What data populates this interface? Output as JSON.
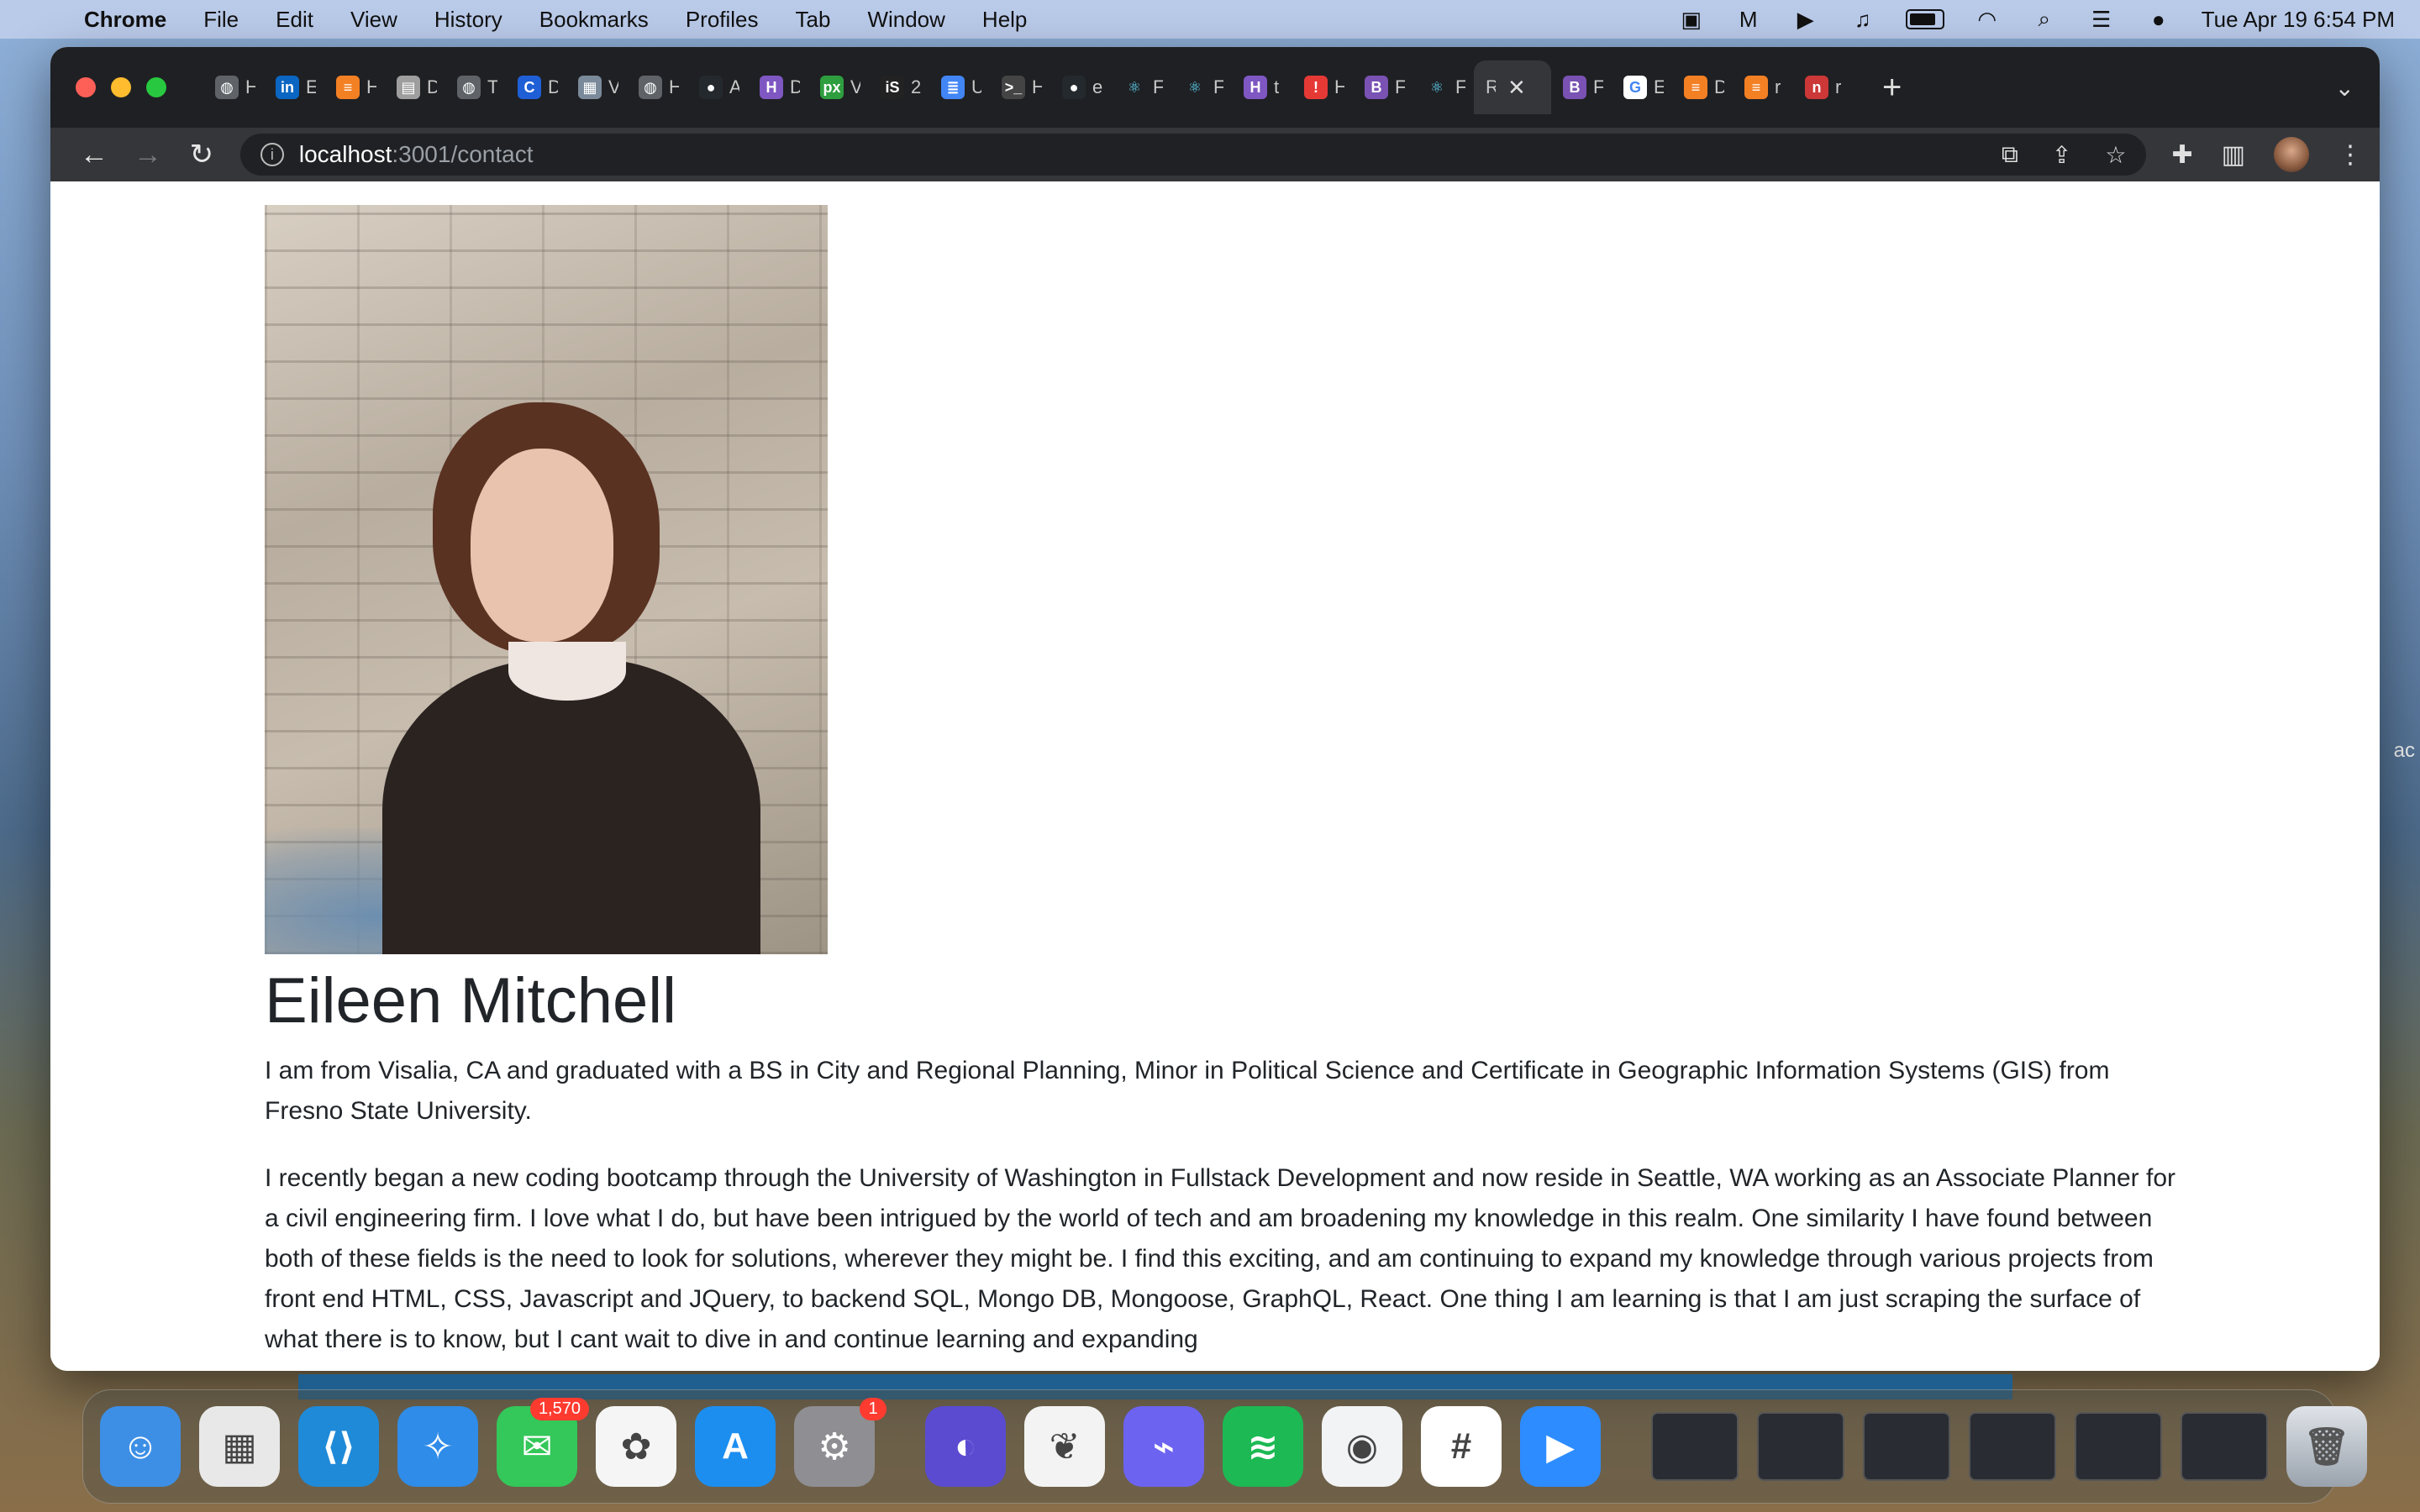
{
  "menubar": {
    "app_name": "Chrome",
    "items": [
      "File",
      "Edit",
      "View",
      "History",
      "Bookmarks",
      "Profiles",
      "Tab",
      "Window",
      "Help"
    ],
    "clock": "Tue Apr 19  6:54 PM"
  },
  "browser": {
    "tabs": [
      {
        "icon": "globe",
        "title": "H"
      },
      {
        "icon": "linkedin",
        "title": "E"
      },
      {
        "icon": "stackoverflow",
        "title": "H"
      },
      {
        "icon": "doc",
        "title": "D"
      },
      {
        "icon": "globe",
        "title": "T"
      },
      {
        "icon": "c-logo",
        "title": "D"
      },
      {
        "icon": "image",
        "title": "V"
      },
      {
        "icon": "globe",
        "title": "H"
      },
      {
        "icon": "github",
        "title": "A"
      },
      {
        "icon": "h-logo",
        "title": "D"
      },
      {
        "icon": "px",
        "title": "V"
      },
      {
        "icon": "is-logo",
        "title": "2"
      },
      {
        "icon": "gdocs",
        "title": "U"
      },
      {
        "icon": "terminal",
        "title": "H"
      },
      {
        "icon": "github",
        "title": "e"
      },
      {
        "icon": "react",
        "title": "F"
      },
      {
        "icon": "react",
        "title": "F"
      },
      {
        "icon": "h-logo",
        "title": "t"
      },
      {
        "icon": "alert",
        "title": "H"
      },
      {
        "icon": "bootstrap",
        "title": "F"
      },
      {
        "icon": "react",
        "title": "F"
      },
      {
        "icon": "r-letter",
        "title": "R",
        "active": true
      },
      {
        "icon": "bootstrap",
        "title": "F"
      },
      {
        "icon": "google",
        "title": "E"
      },
      {
        "icon": "stackoverflow",
        "title": "D"
      },
      {
        "icon": "stackoverflow",
        "title": "r"
      },
      {
        "icon": "npm",
        "title": "r"
      }
    ],
    "url_host": "localhost",
    "url_path": ":3001/contact"
  },
  "page": {
    "name": "Eileen Mitchell",
    "paragraph1": "I am from Visalia, CA and graduated with a BS in City and Regional Planning, Minor in Political Science and Certificate in Geographic Information Systems (GIS) from Fresno State University.",
    "paragraph2": "I recently began a new coding bootcamp through the University of Washington in Fullstack Development and now reside in Seattle, WA working as an Associate Planner for a civil engineering firm. I love what I do, but have been intrigued by the world of tech and am broadening my knowledge in this realm. One similarity I have found between both of these fields is the need to look for solutions, wherever they might be. I find this exciting, and am continuing to expand my knowledge through various projects from front end HTML, CSS, Javascript and JQuery, to backend SQL, Mongo DB, Mongoose, GraphQL, React. One thing I am learning is that I am just scraping the surface of what there is to know, but I cant wait to dive in and continue learning and expanding"
  },
  "desktop": {
    "edge_text": "ac"
  },
  "dock": {
    "apps": [
      {
        "name": "finder",
        "color": "#3d8fe6"
      },
      {
        "name": "launchpad",
        "color": "#e8e8e8"
      },
      {
        "name": "vscode",
        "color": "#1f8ad8"
      },
      {
        "name": "safari",
        "color": "#2f8ce8"
      },
      {
        "name": "messages",
        "color": "#34c759",
        "badge": "1,570"
      },
      {
        "name": "photos",
        "color": "#f5f5f5"
      },
      {
        "name": "app-store",
        "color": "#1c8ef0"
      },
      {
        "name": "system-preferences",
        "color": "#8e8e93",
        "badge": "1"
      }
    ],
    "apps2": [
      {
        "name": "app-circle",
        "color": "#5a4bd1"
      },
      {
        "name": "mongodb-compass",
        "color": "#f3f3f3"
      },
      {
        "name": "messenger",
        "color": "#6c63f0"
      },
      {
        "name": "spotify",
        "color": "#1db954"
      },
      {
        "name": "chrome",
        "color": "#f1f3f4"
      },
      {
        "name": "slack",
        "color": "#ffffff"
      },
      {
        "name": "zoom",
        "color": "#2d8cff"
      }
    ]
  }
}
